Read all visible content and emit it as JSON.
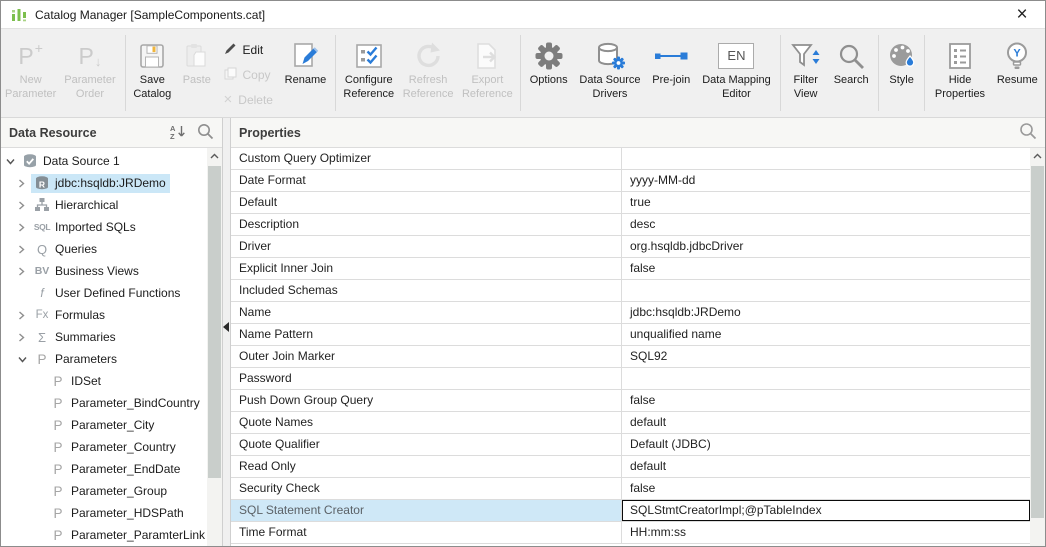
{
  "window": {
    "title": "Catalog Manager [SampleComponents.cat]"
  },
  "icons": {
    "close": "×",
    "plus": "+",
    "down_arrow": "↓",
    "en": "EN",
    "y": "Y",
    "r": "R",
    "delete_x": "×",
    "sort_a": "A",
    "sort_z": "Z"
  },
  "colors": {
    "accent_blue": "#2a7cd8",
    "logo_green": "#7cbf4d",
    "tree_selection": "#cbe7f7",
    "row_highlight": "#cfe8f7",
    "icon_gray": "#9aa0a6"
  },
  "toolbar": {
    "new_parameter": {
      "label": "New Parameter"
    },
    "parameter_order": {
      "label": "Parameter Order"
    },
    "save_catalog": {
      "label": "Save Catalog"
    },
    "paste": {
      "label": "Paste"
    },
    "edit": {
      "label": "Edit"
    },
    "copy": {
      "label": "Copy"
    },
    "delete": {
      "label": "Delete"
    },
    "rename": {
      "label": "Rename"
    },
    "configure_reference": {
      "label": "Configure Reference"
    },
    "refresh_reference": {
      "label": "Refresh Reference"
    },
    "export_reference": {
      "label": "Export Reference"
    },
    "options": {
      "label": "Options"
    },
    "data_source_drivers": {
      "label": "Data Source Drivers"
    },
    "pre_join": {
      "label": "Pre-join"
    },
    "data_mapping_editor": {
      "label": "Data Mapping Editor"
    },
    "filter_view": {
      "label": "Filter View"
    },
    "search": {
      "label": "Search"
    },
    "style": {
      "label": "Style"
    },
    "hide_properties": {
      "label": "Hide Properties"
    },
    "resume": {
      "label": "Resume"
    }
  },
  "left_panel": {
    "title": "Data Resource",
    "tree": [
      {
        "label": "Data Source 1"
      },
      {
        "label": "jdbc:hsqldb:JRDemo",
        "icon_letter": "R"
      },
      {
        "label": "Hierarchical"
      },
      {
        "label": "Imported SQLs",
        "icon_letter": "SQL"
      },
      {
        "label": "Queries",
        "icon_letter": "Q"
      },
      {
        "label": "Business Views",
        "icon_letter": "BV"
      },
      {
        "label": "User Defined Functions",
        "icon_letter": "f"
      },
      {
        "label": "Formulas",
        "icon_letter": "Fx"
      },
      {
        "label": "Summaries",
        "icon_letter": "Σ"
      },
      {
        "label": "Parameters",
        "icon_letter": "P"
      },
      {
        "label": "IDSet",
        "icon_letter": "P"
      },
      {
        "label": "Parameter_BindCountry",
        "icon_letter": "P"
      },
      {
        "label": "Parameter_City",
        "icon_letter": "P"
      },
      {
        "label": "Parameter_Country",
        "icon_letter": "P"
      },
      {
        "label": "Parameter_EndDate",
        "icon_letter": "P"
      },
      {
        "label": "Parameter_Group",
        "icon_letter": "P"
      },
      {
        "label": "Parameter_HDSPath",
        "icon_letter": "P"
      },
      {
        "label": "Parameter_ParamterLink",
        "icon_letter": "P"
      }
    ]
  },
  "properties": {
    "title": "Properties",
    "rows": [
      {
        "name": "Custom Query Optimizer",
        "value": ""
      },
      {
        "name": "Date Format",
        "value": "yyyy-MM-dd"
      },
      {
        "name": "Default",
        "value": "true"
      },
      {
        "name": "Description",
        "value": "desc"
      },
      {
        "name": "Driver",
        "value": "org.hsqldb.jdbcDriver"
      },
      {
        "name": "Explicit Inner Join",
        "value": "false"
      },
      {
        "name": "Included Schemas",
        "value": ""
      },
      {
        "name": "Name",
        "value": "jdbc:hsqldb:JRDemo"
      },
      {
        "name": "Name Pattern",
        "value": "unqualified name"
      },
      {
        "name": "Outer Join Marker",
        "value": "SQL92"
      },
      {
        "name": "Password",
        "value": ""
      },
      {
        "name": "Push Down Group Query",
        "value": "false"
      },
      {
        "name": "Quote Names",
        "value": "default"
      },
      {
        "name": "Quote Qualifier",
        "value": "Default (JDBC)"
      },
      {
        "name": "Read Only",
        "value": "default"
      },
      {
        "name": "Security Check",
        "value": "false"
      },
      {
        "name": "SQL Statement Creator",
        "value": "SQLStmtCreatorImpl;@pTableIndex",
        "highlighted": true
      },
      {
        "name": "Time Format",
        "value": "HH:mm:ss"
      }
    ]
  }
}
